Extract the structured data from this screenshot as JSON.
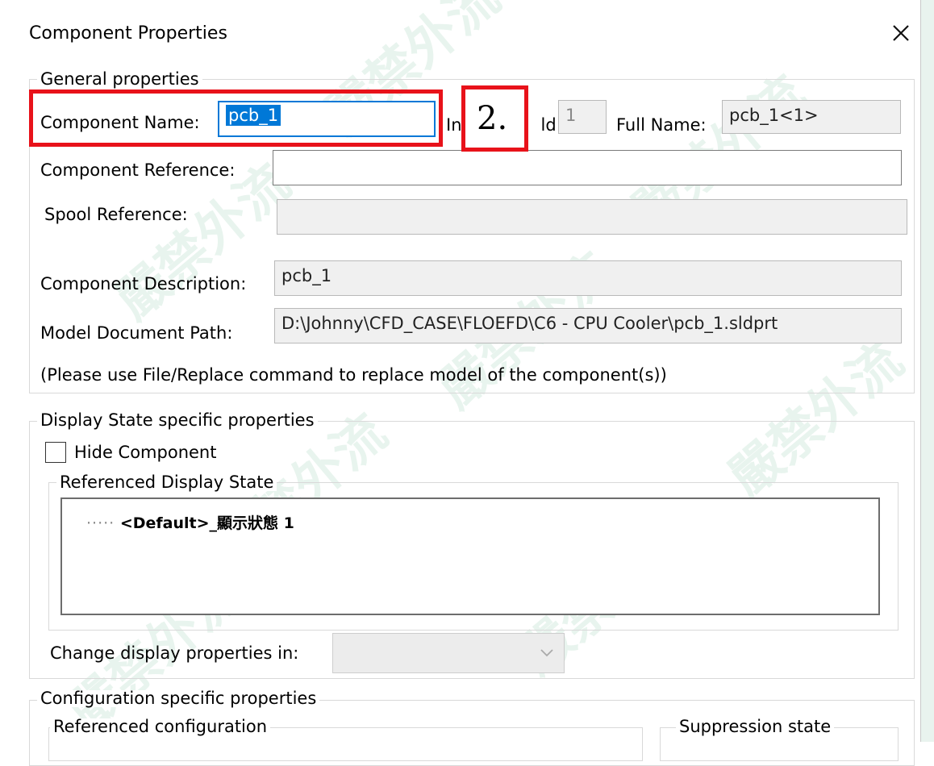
{
  "window": {
    "title": "Component Properties"
  },
  "general": {
    "legend": "General properties",
    "component_name_label": "Component Name:",
    "component_name_value": "pcb_1",
    "instance_id_label_left": "In",
    "instance_id_label_right": "ld:",
    "instance_id_value": "1",
    "full_name_label": "Full Name:",
    "full_name_value": "pcb_1<1>",
    "component_reference_label": "Component Reference:",
    "component_reference_value": "",
    "spool_reference_label": "Spool Reference:",
    "spool_reference_value": "",
    "component_description_label": "Component Description:",
    "component_description_value": "pcb_1",
    "model_path_label": "Model Document Path:",
    "model_path_value": "D:\\Johnny\\CFD_CASE\\FLOEFD\\C6 - CPU Cooler\\pcb_1.sldprt",
    "replace_note": "(Please use File/Replace command to replace model of the component(s))"
  },
  "annotation": {
    "step_label": "2."
  },
  "display_state": {
    "legend": "Display State specific properties",
    "hide_component_label": "Hide Component",
    "hide_component_checked": false,
    "referenced_legend": "Referenced Display State",
    "tree_items": [
      "<Default>_顯示狀態 1"
    ],
    "change_display_label": "Change display properties in:",
    "change_display_value": ""
  },
  "configuration": {
    "legend": "Configuration specific properties",
    "referenced_configuration_label": "Referenced configuration",
    "suppression_state_label": "Suppression state"
  },
  "colors": {
    "accent": "#0078d7",
    "annotation_red": "#e8121a"
  }
}
